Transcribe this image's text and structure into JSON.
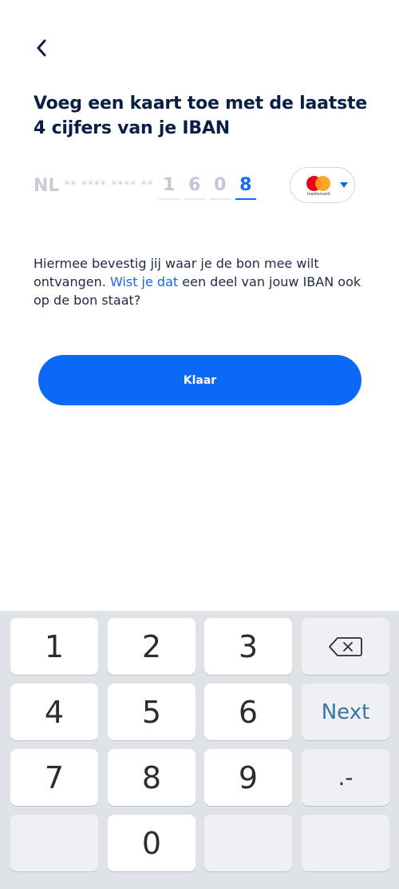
{
  "header": {
    "back_icon": "chevron-left-icon"
  },
  "title": "Voeg een kaart toe met de laatste 4 cijfers van je IBAN",
  "iban": {
    "country": "NL",
    "masked": "** **** **** **",
    "digits": [
      "1",
      "6",
      "0",
      "8"
    ],
    "active_digit_index": 3
  },
  "card_selector": {
    "brand": "mastercard",
    "brand_label": "mastercard",
    "icon": "chevron-down-icon"
  },
  "info": {
    "text_before": "Hiermee bevestig jij waar je de bon mee wilt ontvangen.",
    "link": "Wist je dat",
    "text_after": "een deel van jouw IBAN ook op de bon staat?"
  },
  "primary_button": {
    "label": "Klaar"
  },
  "keyboard": {
    "keys": [
      "1",
      "2",
      "3",
      "4",
      "5",
      "6",
      "7",
      "8",
      "9",
      "0"
    ],
    "next_label": "Next",
    "punct_label": ".-",
    "backspace_icon": "backspace-icon"
  },
  "colors": {
    "accent": "#0a6af6",
    "title": "#0a1f44",
    "link": "#1668ec",
    "keyboard_bg": "#dfe2e7"
  }
}
